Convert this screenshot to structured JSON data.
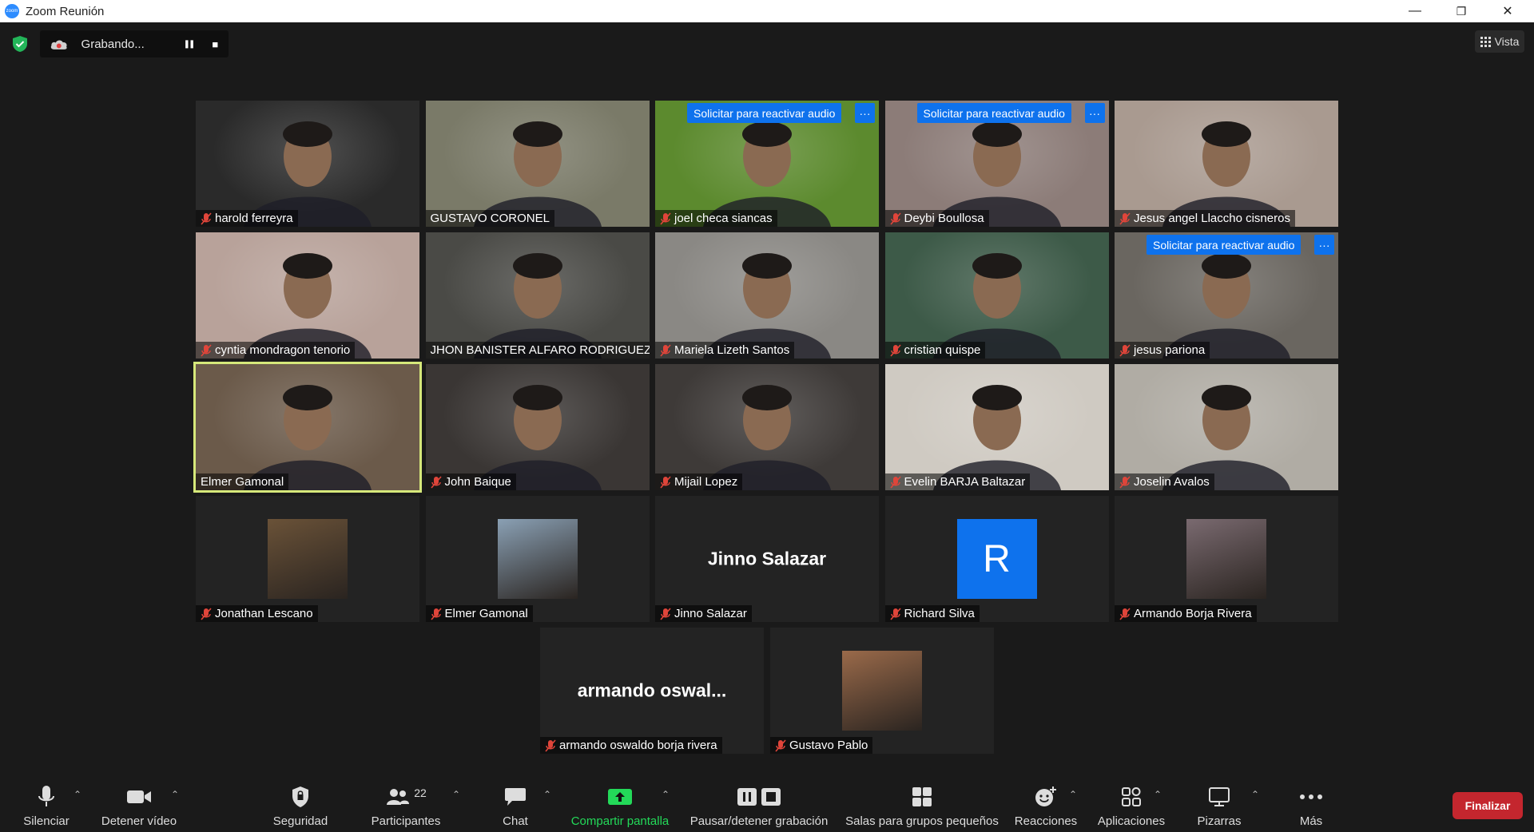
{
  "window": {
    "title": "Zoom Reunión",
    "minimize": "—",
    "restore": "❐",
    "close": "✕"
  },
  "recording": {
    "label": "Grabando...",
    "pause": "❚❚",
    "stop": "■"
  },
  "view": {
    "label": "Vista",
    "icon": "grid-icon"
  },
  "reactivate_label": "Solicitar para reactivar audio",
  "more_label": "···",
  "participants": [
    {
      "name": "harold ferreyra",
      "muted": true,
      "type": "video",
      "bg": "#2a2a2a",
      "reactivate": false
    },
    {
      "name": "GUSTAVO CORONEL",
      "muted": false,
      "type": "video",
      "bg": "#7a7a68",
      "reactivate": false
    },
    {
      "name": "joel checa siancas",
      "muted": true,
      "type": "video",
      "bg": "#5c8a2e",
      "reactivate": true
    },
    {
      "name": "Deybi Boullosa",
      "muted": true,
      "type": "video",
      "bg": "#8c7c78",
      "reactivate": true
    },
    {
      "name": "Jesus angel Llaccho cisneros",
      "muted": true,
      "type": "video",
      "bg": "#a99a90",
      "reactivate": false
    },
    {
      "name": "cyntia mondragon tenorio",
      "muted": true,
      "type": "video",
      "bg": "#b8a29a",
      "reactivate": false
    },
    {
      "name": "JHON BANISTER ALFARO RODRIGUEZ",
      "muted": false,
      "type": "video",
      "bg": "#4a4a46",
      "reactivate": false
    },
    {
      "name": "Mariela Lizeth Santos",
      "muted": true,
      "type": "video",
      "bg": "#8a8884",
      "reactivate": false
    },
    {
      "name": "cristian quispe",
      "muted": true,
      "type": "video",
      "bg": "#3d5a48",
      "reactivate": false
    },
    {
      "name": "jesus pariona",
      "muted": true,
      "type": "video",
      "bg": "#6a6660",
      "reactivate": true
    },
    {
      "name": "Elmer Gamonal",
      "muted": false,
      "type": "video",
      "bg": "#6b5a4a",
      "reactivate": false,
      "active": true
    },
    {
      "name": "John Baique",
      "muted": true,
      "type": "video",
      "bg": "#3a3634",
      "reactivate": false
    },
    {
      "name": "Mijail Lopez",
      "muted": true,
      "type": "video",
      "bg": "#3e3a38",
      "reactivate": false
    },
    {
      "name": "Evelin BARJA  Baltazar",
      "muted": true,
      "type": "video",
      "bg": "#cfcac2",
      "reactivate": false
    },
    {
      "name": "Joselin Avalos",
      "muted": true,
      "type": "video",
      "bg": "#b0aca4",
      "reactivate": false
    },
    {
      "name": "Jonathan Lescano",
      "muted": true,
      "type": "photo",
      "bg": "#232323",
      "photo": "#6a5238",
      "reactivate": false
    },
    {
      "name": "Elmer Gamonal",
      "muted": true,
      "type": "photo",
      "bg": "#232323",
      "photo": "#8aa0b4",
      "reactivate": false
    },
    {
      "name": "Jinno Salazar",
      "muted": true,
      "type": "text",
      "bg": "#232323",
      "display": "Jinno Salazar",
      "reactivate": false
    },
    {
      "name": "Richard Silva",
      "muted": true,
      "type": "initial",
      "bg": "#232323",
      "initial": "R",
      "reactivate": false
    },
    {
      "name": "Armando Borja Rivera",
      "muted": true,
      "type": "photo",
      "bg": "#232323",
      "photo": "#7a6a70",
      "reactivate": false
    },
    {
      "name": "armando oswaldo borja rivera",
      "muted": true,
      "type": "text",
      "bg": "#232323",
      "display": "armando  oswal...",
      "reactivate": false
    },
    {
      "name": "Gustavo Pablo",
      "muted": true,
      "type": "photo",
      "bg": "#232323",
      "photo": "#9a6a4a",
      "reactivate": false
    }
  ],
  "toolbar": {
    "mute": "Silenciar",
    "video": "Detener vídeo",
    "security": "Seguridad",
    "participants": "Participantes",
    "participants_count": "22",
    "chat": "Chat",
    "share": "Compartir pantalla",
    "record": "Pausar/detener grabación",
    "breakout": "Salas para grupos pequeños",
    "reactions": "Reacciones",
    "apps": "Aplicaciones",
    "whiteboards": "Pizarras",
    "more": "Más",
    "end": "Finalizar"
  },
  "colors": {
    "accent": "#0e72ed",
    "share_green": "#23d959",
    "end_red": "#c4262e",
    "active_speaker": "#d6e87a"
  }
}
